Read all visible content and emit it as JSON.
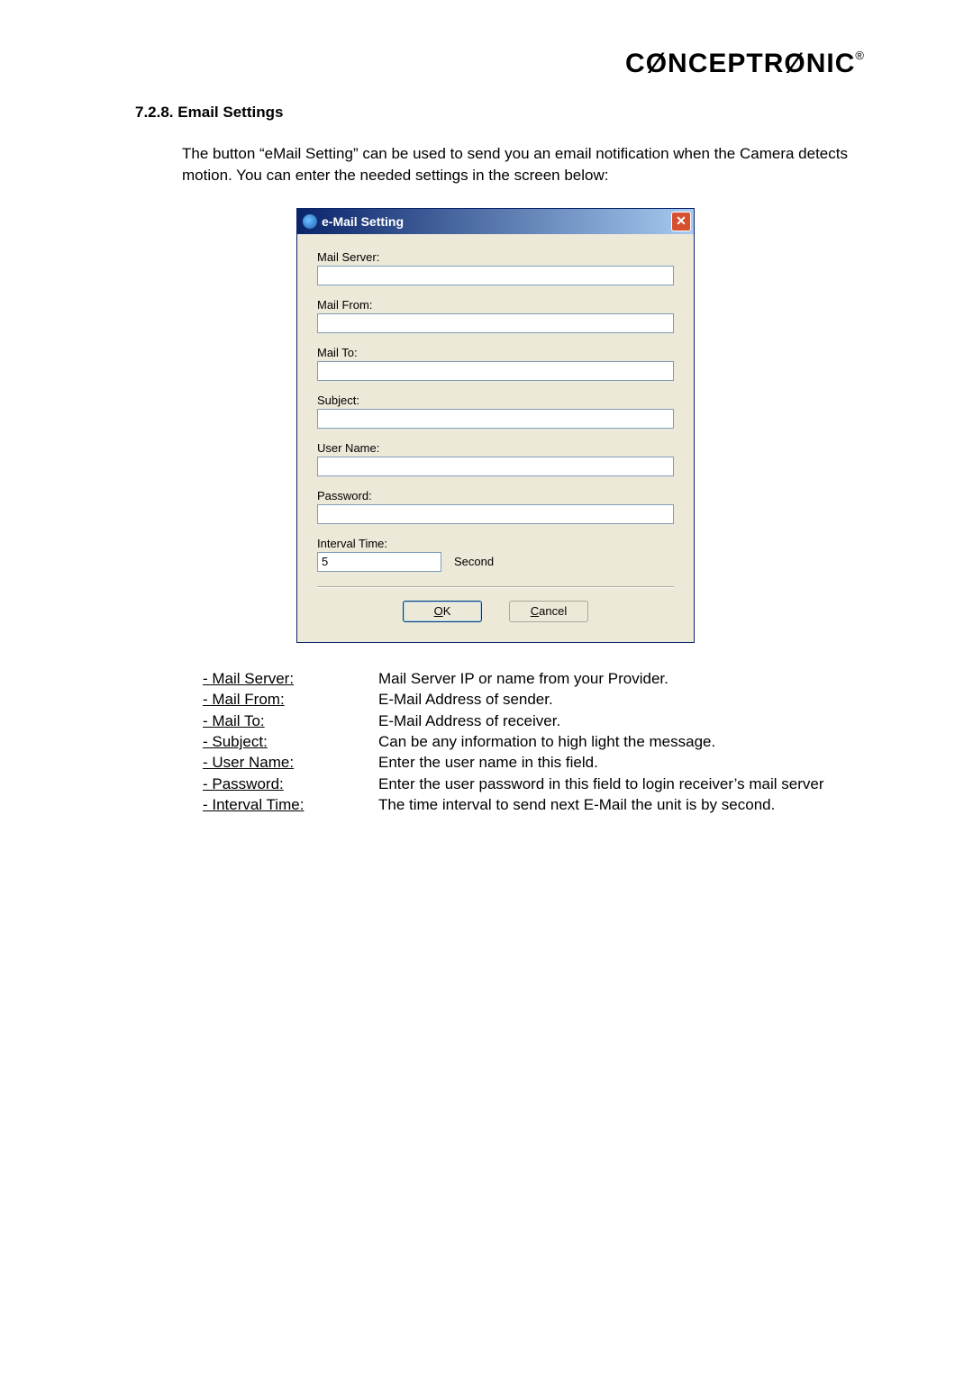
{
  "brand": "CONCEPTRONIC",
  "brand_marks": {
    "o1": "Ø",
    "o2": "Ø"
  },
  "section": {
    "number": "7.2.8.",
    "title": "Email Settings"
  },
  "intro": "The button “eMail Setting” can be used to send you an email notification when the Camera detects motion. You can enter the needed settings in the screen below:",
  "dialog": {
    "title": "e-Mail Setting",
    "fields": {
      "mail_server": {
        "label": "Mail Server:",
        "value": ""
      },
      "mail_from": {
        "label": "Mail From:",
        "value": ""
      },
      "mail_to": {
        "label": "Mail To:",
        "value": ""
      },
      "subject": {
        "label": "Subject:",
        "value": ""
      },
      "user_name": {
        "label": "User Name:",
        "value": ""
      },
      "password": {
        "label": "Password:",
        "value": ""
      },
      "interval": {
        "label": "Interval Time:",
        "value": "5",
        "unit": "Second"
      }
    },
    "buttons": {
      "ok": "OK",
      "cancel": "Cancel"
    }
  },
  "definitions": [
    {
      "term": "- Mail Server:",
      "desc": "Mail Server IP or name from your Provider."
    },
    {
      "term": "- Mail From:",
      "desc": "E-Mail Address of sender."
    },
    {
      "term": "- Mail To:",
      "desc": "E-Mail Address of receiver."
    },
    {
      "term": "- Subject:",
      "desc": "Can be any information to high light the message."
    },
    {
      "term": "- User Name:",
      "desc": "Enter the user name in this field."
    },
    {
      "term": "- Password:",
      "desc": "Enter the user password in this field to login receiver’s mail server"
    },
    {
      "term": "- Interval Time:",
      "desc": "The time interval to send next E-Mail the unit is by second."
    }
  ]
}
